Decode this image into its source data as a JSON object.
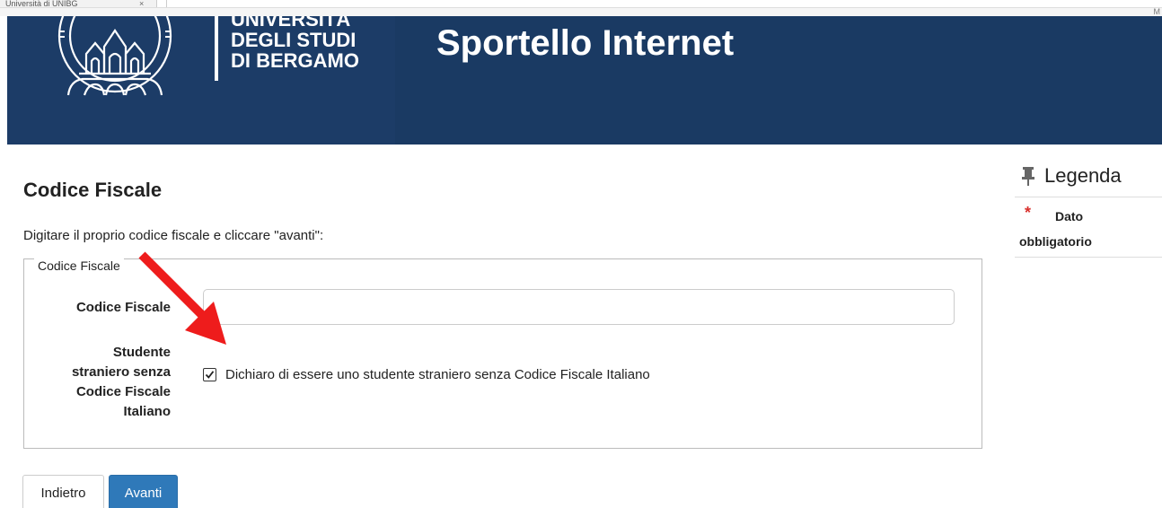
{
  "browser": {
    "tab_title": "Università di UNIBG",
    "tab_close": "×",
    "corner_text": "M"
  },
  "header": {
    "university_lines": [
      "UNIVERSITÀ",
      "DEGLI STUDI",
      "DI BERGAMO"
    ],
    "site_title": "Sportello Internet",
    "logo_icon": "university-seal-icon"
  },
  "main": {
    "page_title": "Codice Fiscale",
    "instructions": "Digitare il proprio codice fiscale e cliccare \"avanti\":",
    "fieldset_legend": "Codice Fiscale",
    "codice_fiscale_label": "Codice Fiscale",
    "codice_fiscale_value": "",
    "student_label_lines": [
      "Studente",
      "straniero senza",
      "Codice Fiscale",
      "Italiano"
    ],
    "checkbox_checked": true,
    "checkbox_label": "Dichiaro di essere uno studente straniero senza Codice Fiscale Italiano"
  },
  "buttons": {
    "back": "Indietro",
    "next": "Avanti"
  },
  "legenda": {
    "title": "Legenda",
    "required_symbol": "*",
    "required_text": "Dato obbligatorio"
  },
  "colors": {
    "banner": "#1c3c67",
    "primary_button": "#2f79b9",
    "required_star": "#d9302c",
    "annotation_arrow": "#ee1c1c"
  }
}
